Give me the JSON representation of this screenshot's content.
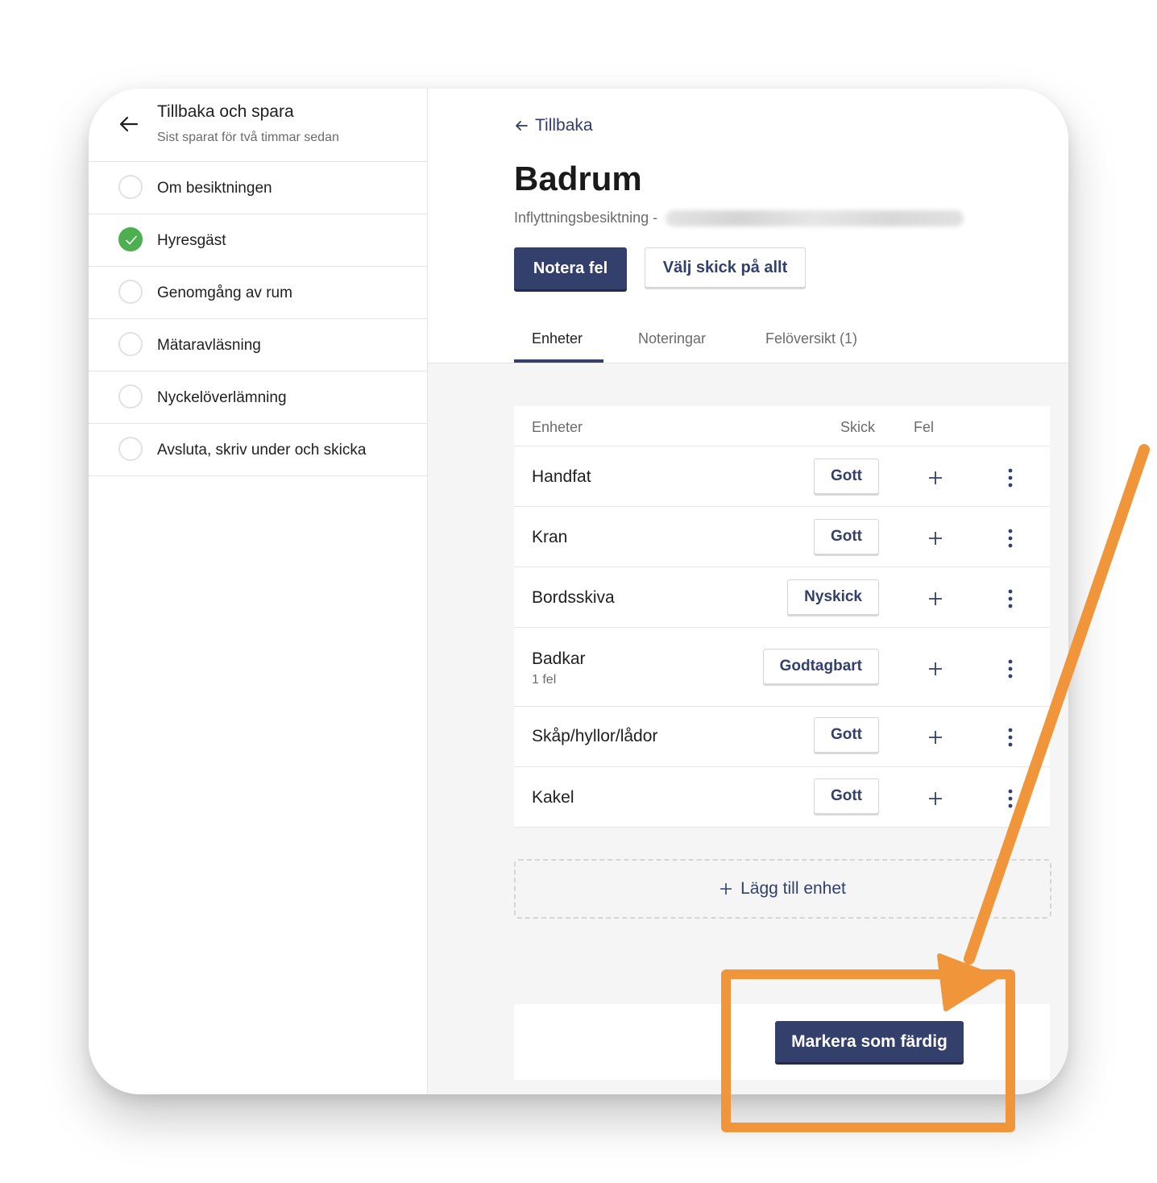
{
  "sidebar": {
    "title": "Tillbaka och spara",
    "subtitle": "Sist sparat för två timmar sedan",
    "steps": [
      {
        "label": "Om besiktningen",
        "done": false
      },
      {
        "label": "Hyresgäst",
        "done": true
      },
      {
        "label": "Genomgång av rum",
        "done": false
      },
      {
        "label": "Mätaravläsning",
        "done": false
      },
      {
        "label": "Nyckelöverlämning",
        "done": false
      },
      {
        "label": "Avsluta, skriv under och skicka",
        "done": false
      }
    ]
  },
  "main": {
    "back_label": "Tillbaka",
    "title": "Badrum",
    "subtitle": "Inflyttningsbesiktning -",
    "primary_button": "Notera fel",
    "secondary_button": "Välj skick på allt",
    "tabs": [
      {
        "label": "Enheter",
        "active": true
      },
      {
        "label": "Noteringar",
        "active": false
      },
      {
        "label": "Felöversikt (1)",
        "active": false
      }
    ],
    "table": {
      "headers": {
        "name": "Enheter",
        "condition": "Skick",
        "faults": "Fel"
      },
      "rows": [
        {
          "name": "Handfat",
          "condition": "Gott"
        },
        {
          "name": "Kran",
          "condition": "Gott"
        },
        {
          "name": "Bordsskiva",
          "condition": "Nyskick"
        },
        {
          "name": "Badkar",
          "note": "1 fel",
          "condition": "Godtagbart"
        },
        {
          "name": "Skåp/hyllor/lådor",
          "condition": "Gott"
        },
        {
          "name": "Kakel",
          "condition": "Gott"
        }
      ]
    },
    "add_unit_label": "Lägg till enhet",
    "done_button": "Markera som färdig"
  },
  "colors": {
    "primary": "#33406b",
    "success": "#4caf50",
    "annotation": "#f0953a"
  }
}
